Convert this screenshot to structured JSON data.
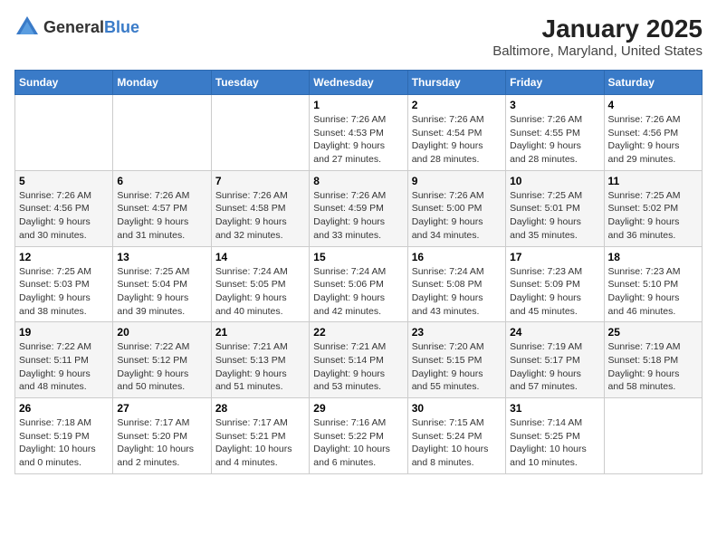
{
  "app": {
    "logo_general": "General",
    "logo_blue": "Blue"
  },
  "header": {
    "title": "January 2025",
    "subtitle": "Baltimore, Maryland, United States"
  },
  "days_of_week": [
    "Sunday",
    "Monday",
    "Tuesday",
    "Wednesday",
    "Thursday",
    "Friday",
    "Saturday"
  ],
  "weeks": [
    [
      {
        "day": "",
        "detail": ""
      },
      {
        "day": "",
        "detail": ""
      },
      {
        "day": "",
        "detail": ""
      },
      {
        "day": "1",
        "detail": "Sunrise: 7:26 AM\nSunset: 4:53 PM\nDaylight: 9 hours\nand 27 minutes."
      },
      {
        "day": "2",
        "detail": "Sunrise: 7:26 AM\nSunset: 4:54 PM\nDaylight: 9 hours\nand 28 minutes."
      },
      {
        "day": "3",
        "detail": "Sunrise: 7:26 AM\nSunset: 4:55 PM\nDaylight: 9 hours\nand 28 minutes."
      },
      {
        "day": "4",
        "detail": "Sunrise: 7:26 AM\nSunset: 4:56 PM\nDaylight: 9 hours\nand 29 minutes."
      }
    ],
    [
      {
        "day": "5",
        "detail": "Sunrise: 7:26 AM\nSunset: 4:56 PM\nDaylight: 9 hours\nand 30 minutes."
      },
      {
        "day": "6",
        "detail": "Sunrise: 7:26 AM\nSunset: 4:57 PM\nDaylight: 9 hours\nand 31 minutes."
      },
      {
        "day": "7",
        "detail": "Sunrise: 7:26 AM\nSunset: 4:58 PM\nDaylight: 9 hours\nand 32 minutes."
      },
      {
        "day": "8",
        "detail": "Sunrise: 7:26 AM\nSunset: 4:59 PM\nDaylight: 9 hours\nand 33 minutes."
      },
      {
        "day": "9",
        "detail": "Sunrise: 7:26 AM\nSunset: 5:00 PM\nDaylight: 9 hours\nand 34 minutes."
      },
      {
        "day": "10",
        "detail": "Sunrise: 7:25 AM\nSunset: 5:01 PM\nDaylight: 9 hours\nand 35 minutes."
      },
      {
        "day": "11",
        "detail": "Sunrise: 7:25 AM\nSunset: 5:02 PM\nDaylight: 9 hours\nand 36 minutes."
      }
    ],
    [
      {
        "day": "12",
        "detail": "Sunrise: 7:25 AM\nSunset: 5:03 PM\nDaylight: 9 hours\nand 38 minutes."
      },
      {
        "day": "13",
        "detail": "Sunrise: 7:25 AM\nSunset: 5:04 PM\nDaylight: 9 hours\nand 39 minutes."
      },
      {
        "day": "14",
        "detail": "Sunrise: 7:24 AM\nSunset: 5:05 PM\nDaylight: 9 hours\nand 40 minutes."
      },
      {
        "day": "15",
        "detail": "Sunrise: 7:24 AM\nSunset: 5:06 PM\nDaylight: 9 hours\nand 42 minutes."
      },
      {
        "day": "16",
        "detail": "Sunrise: 7:24 AM\nSunset: 5:08 PM\nDaylight: 9 hours\nand 43 minutes."
      },
      {
        "day": "17",
        "detail": "Sunrise: 7:23 AM\nSunset: 5:09 PM\nDaylight: 9 hours\nand 45 minutes."
      },
      {
        "day": "18",
        "detail": "Sunrise: 7:23 AM\nSunset: 5:10 PM\nDaylight: 9 hours\nand 46 minutes."
      }
    ],
    [
      {
        "day": "19",
        "detail": "Sunrise: 7:22 AM\nSunset: 5:11 PM\nDaylight: 9 hours\nand 48 minutes."
      },
      {
        "day": "20",
        "detail": "Sunrise: 7:22 AM\nSunset: 5:12 PM\nDaylight: 9 hours\nand 50 minutes."
      },
      {
        "day": "21",
        "detail": "Sunrise: 7:21 AM\nSunset: 5:13 PM\nDaylight: 9 hours\nand 51 minutes."
      },
      {
        "day": "22",
        "detail": "Sunrise: 7:21 AM\nSunset: 5:14 PM\nDaylight: 9 hours\nand 53 minutes."
      },
      {
        "day": "23",
        "detail": "Sunrise: 7:20 AM\nSunset: 5:15 PM\nDaylight: 9 hours\nand 55 minutes."
      },
      {
        "day": "24",
        "detail": "Sunrise: 7:19 AM\nSunset: 5:17 PM\nDaylight: 9 hours\nand 57 minutes."
      },
      {
        "day": "25",
        "detail": "Sunrise: 7:19 AM\nSunset: 5:18 PM\nDaylight: 9 hours\nand 58 minutes."
      }
    ],
    [
      {
        "day": "26",
        "detail": "Sunrise: 7:18 AM\nSunset: 5:19 PM\nDaylight: 10 hours\nand 0 minutes."
      },
      {
        "day": "27",
        "detail": "Sunrise: 7:17 AM\nSunset: 5:20 PM\nDaylight: 10 hours\nand 2 minutes."
      },
      {
        "day": "28",
        "detail": "Sunrise: 7:17 AM\nSunset: 5:21 PM\nDaylight: 10 hours\nand 4 minutes."
      },
      {
        "day": "29",
        "detail": "Sunrise: 7:16 AM\nSunset: 5:22 PM\nDaylight: 10 hours\nand 6 minutes."
      },
      {
        "day": "30",
        "detail": "Sunrise: 7:15 AM\nSunset: 5:24 PM\nDaylight: 10 hours\nand 8 minutes."
      },
      {
        "day": "31",
        "detail": "Sunrise: 7:14 AM\nSunset: 5:25 PM\nDaylight: 10 hours\nand 10 minutes."
      },
      {
        "day": "",
        "detail": ""
      }
    ]
  ]
}
